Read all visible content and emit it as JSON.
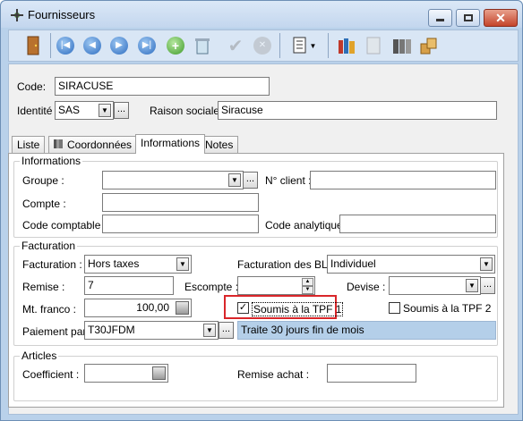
{
  "window": {
    "title": "Fournisseurs"
  },
  "header": {
    "code_label": "Code:",
    "code_value": "SIRACUSE",
    "identite_label": "Identité :",
    "identite_value": "SAS",
    "raison_label": "Raison sociale :",
    "raison_value": "Siracuse"
  },
  "tabs": [
    {
      "label": "Liste"
    },
    {
      "label": "Coordonnées"
    },
    {
      "label": "Informations"
    },
    {
      "label": "Notes"
    }
  ],
  "informations": {
    "group_label": "Informations",
    "groupe_label": "Groupe :",
    "groupe_value": "",
    "nclient_label": "N° client :",
    "nclient_value": "",
    "compte_label": "Compte :",
    "compte_value": "",
    "code_comptable_label": "Code comptable :",
    "code_comptable_value": "",
    "code_analytique_label": "Code analytique :",
    "code_analytique_value": ""
  },
  "facturation": {
    "group_label": "Facturation",
    "facturation_label": "Facturation :",
    "facturation_value": "Hors taxes",
    "fact_bl_label": "Facturation des BL :",
    "fact_bl_value": "Individuel",
    "remise_label": "Remise :",
    "remise_value": "7",
    "escompte_label": "Escompte :",
    "escompte_value": "",
    "devise_label": "Devise :",
    "devise_value": "",
    "mt_franco_label": "Mt. franco :",
    "mt_franco_value": "100,00",
    "tpf1_label": "Soumis à la TPF 1",
    "tpf1_checked": true,
    "tpf2_label": "Soumis à la TPF 2",
    "tpf2_checked": false,
    "paiement_label": "Paiement par :",
    "paiement_value": "T30JFDM",
    "paiement_desc": "Traite 30 jours fin de mois"
  },
  "articles": {
    "group_label": "Articles",
    "coefficient_label": "Coefficient :",
    "coefficient_value": "",
    "remise_achat_label": "Remise achat :",
    "remise_achat_value": ""
  },
  "glyphs": {
    "ellipsis": "...",
    "dropdown": "▼",
    "check": "✓",
    "up": "▲",
    "down": "▼"
  },
  "colors": {
    "window_bg": "#b9d1ea",
    "highlight": "#d9262a",
    "desc_bg": "#b4cfe9"
  }
}
